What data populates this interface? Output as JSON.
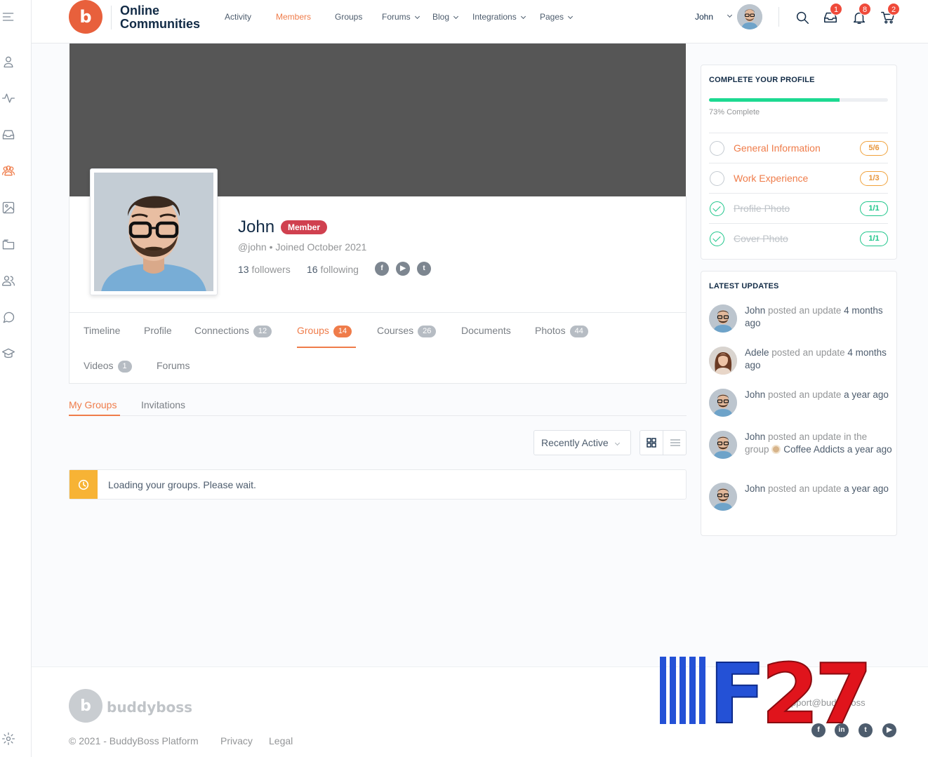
{
  "site": {
    "name": "Online Communities",
    "logo_glyph": "b"
  },
  "nav": {
    "items": [
      {
        "label": "Activity",
        "dropdown": false
      },
      {
        "label": "Members",
        "dropdown": false,
        "active": true
      },
      {
        "label": "Groups",
        "dropdown": false
      },
      {
        "label": "Forums",
        "dropdown": true
      },
      {
        "label": "Blog",
        "dropdown": true
      },
      {
        "label": "Integrations",
        "dropdown": true
      },
      {
        "label": "Pages",
        "dropdown": true
      }
    ],
    "user": "John",
    "badges": {
      "messages": "1",
      "notifications": "8",
      "cart": "2"
    }
  },
  "profile": {
    "name": "John",
    "role_badge": "Member",
    "meta": "@john • Joined October 2021",
    "followers_count": "13",
    "followers_label": "followers",
    "following_count": "16",
    "following_label": "following",
    "social": [
      "f",
      "▶",
      "t"
    ]
  },
  "profile_tabs": [
    {
      "label": "Timeline",
      "count": null
    },
    {
      "label": "Profile",
      "count": null
    },
    {
      "label": "Connections",
      "count": "12"
    },
    {
      "label": "Groups",
      "count": "14",
      "active": true
    },
    {
      "label": "Courses",
      "count": "26"
    },
    {
      "label": "Documents",
      "count": null
    },
    {
      "label": "Photos",
      "count": "44"
    },
    {
      "label": "Videos",
      "count": "1"
    },
    {
      "label": "Forums",
      "count": null
    }
  ],
  "sub_tabs": [
    {
      "label": "My Groups",
      "active": true
    },
    {
      "label": "Invitations"
    }
  ],
  "sort": {
    "selected": "Recently Active"
  },
  "notice": {
    "text": "Loading your groups. Please wait."
  },
  "complete_profile": {
    "title": "COMPLETE YOUR PROFILE",
    "percent": 73,
    "percent_label": "73% Complete",
    "items": [
      {
        "label": "General Information",
        "fraction": "5/6",
        "done": false
      },
      {
        "label": "Work Experience",
        "fraction": "1/3",
        "done": false
      },
      {
        "label": "Profile Photo",
        "fraction": "1/1",
        "done": true
      },
      {
        "label": "Cover Photo",
        "fraction": "1/1",
        "done": true
      }
    ]
  },
  "latest_updates": {
    "title": "LATEST UPDATES",
    "items": [
      {
        "who": "John",
        "text": " posted an update ",
        "tail": "4 months ago"
      },
      {
        "who": "Adele",
        "text": " posted an update ",
        "tail": "4 months ago"
      },
      {
        "who": "John",
        "text": " posted an update ",
        "tail": "a year ago"
      },
      {
        "who": "John",
        "text": " posted an update in the group ",
        "group": "Coffee Addicts",
        "tail": " a year ago"
      },
      {
        "who": "John",
        "text": " posted an update ",
        "tail": "a year ago"
      }
    ]
  },
  "footer": {
    "brand": "buddyboss",
    "copyright": "© 2021 - BuddyBoss Platform",
    "links": [
      "Privacy",
      "Legal"
    ],
    "support": "Support@buddyboss",
    "social": [
      "f",
      "in",
      "t",
      "▶"
    ]
  },
  "watermark": {
    "text": "F27"
  },
  "colors": {
    "accent": "#ef7c4a",
    "success": "#1cd991",
    "badge": "#d0404f",
    "warning": "#f7b335",
    "cover": "#565656"
  }
}
